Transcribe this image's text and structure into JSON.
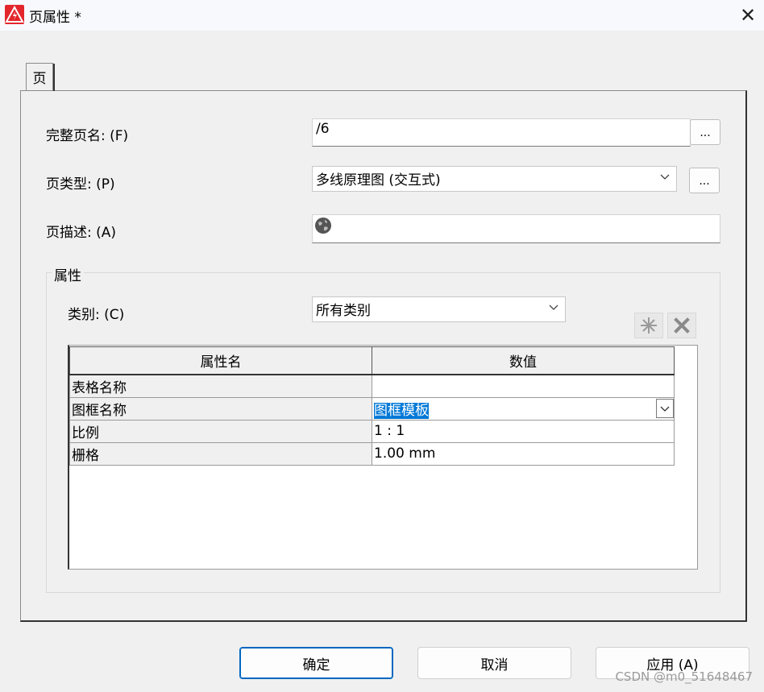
{
  "window": {
    "title": "页属性 *",
    "app_icon": "eplan-warning-icon",
    "close_glyph": "✕"
  },
  "tabs": [
    {
      "label": "页"
    }
  ],
  "form": {
    "full_name_label": "完整页名: (F)",
    "full_name_value": "/6",
    "page_type_label": "页类型: (P)",
    "page_type_value": "多线原理图 (交互式)",
    "description_label": "页描述: (A)",
    "description_value": "",
    "ellipsis": "..."
  },
  "properties": {
    "group_title": "属性",
    "category_label": "类别: (C)",
    "category_value": "所有类别",
    "table": {
      "headers": [
        "属性名",
        "数值"
      ],
      "rows": [
        {
          "name": "表格名称",
          "value": ""
        },
        {
          "name": "图框名称",
          "value": "图框模板"
        },
        {
          "name": "比例",
          "value": "1 : 1"
        },
        {
          "name": "栅格",
          "value": "1.00 mm"
        }
      ]
    }
  },
  "buttons": {
    "ok": "确定",
    "cancel": "取消",
    "apply": "应用 (A)"
  },
  "watermark": "CSDN @m0_51648467",
  "colors": {
    "selection": "#0078d7",
    "default_button_border": "#0067c0",
    "app_icon_red": "#e3262b"
  }
}
